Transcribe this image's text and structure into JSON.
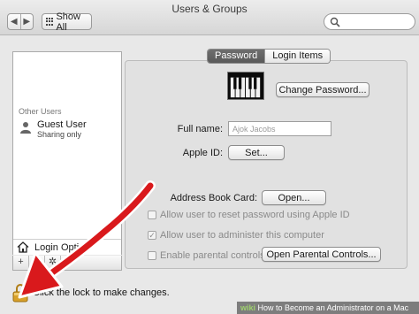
{
  "window": {
    "title": "Users & Groups"
  },
  "toolbar": {
    "show_all_label": "Show All",
    "search_placeholder": ""
  },
  "sidebar": {
    "section_label": "Other Users",
    "users": [
      {
        "name": "Guest User",
        "subtitle": "Sharing only"
      }
    ],
    "login_options_label": "Login Optio",
    "add_symbol": "+",
    "remove_symbol": "−"
  },
  "tabs": [
    {
      "label": "Password",
      "active": true
    },
    {
      "label": "Login Items",
      "active": false
    }
  ],
  "form": {
    "change_password_label": "Change Password...",
    "full_name_label": "Full name:",
    "full_name_value": "Ajok Jacobs",
    "apple_id_label": "Apple ID:",
    "apple_id_button": "Set...",
    "address_book_label": "Address Book Card:",
    "address_book_button": "Open...",
    "reset_password_label": "Allow user to reset password using Apple ID",
    "administer_label": "Allow user to administer this computer",
    "parental_label": "Enable parental controls",
    "open_parental_button": "Open Parental Controls..."
  },
  "lock": {
    "text": "Click the lock to make changes."
  },
  "watermark": {
    "brand": "wiki",
    "text": "How to Become an Administrator on a Mac"
  },
  "colors": {
    "arrow": "#d9191c",
    "lock": "#d8a12a",
    "active_tab": "#626262"
  }
}
